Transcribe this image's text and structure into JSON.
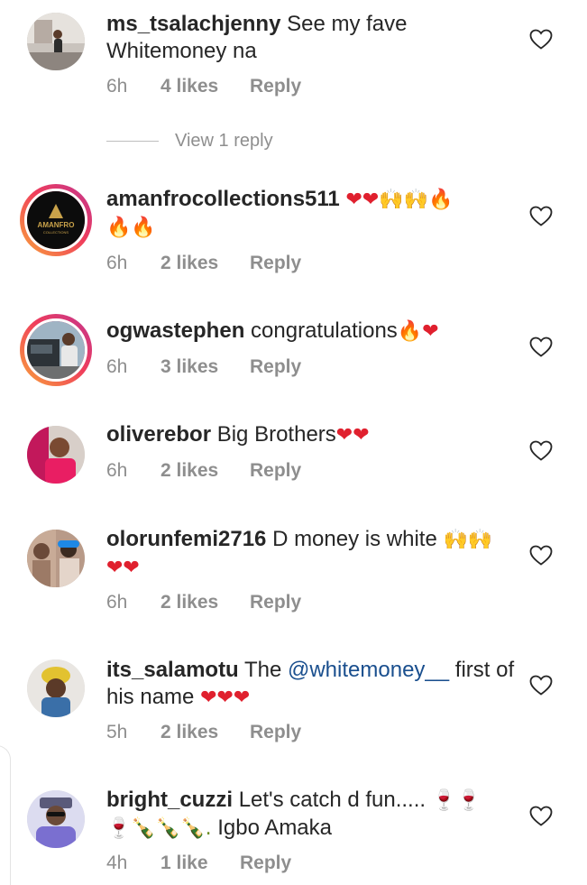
{
  "comments": [
    {
      "username": "ms_tsalachjenny",
      "text": "See my fave Whitemoney na",
      "time": "6h",
      "likes": "4 likes",
      "reply": "Reply",
      "view_replies": "View 1 reply",
      "avatar_ring": false
    },
    {
      "username": "amanfrocollections511",
      "text": "",
      "emoji_line1": "❤❤🙌🙌🔥",
      "emoji_line2": "🔥🔥",
      "time": "6h",
      "likes": "2 likes",
      "reply": "Reply",
      "avatar_ring": true,
      "avatar_logo": "AMANFRO",
      "avatar_logo_sub": "COLLECTIONS"
    },
    {
      "username": "ogwastephen",
      "text": "congratulations",
      "emoji": "🔥❤",
      "time": "6h",
      "likes": "3 likes",
      "reply": "Reply",
      "avatar_ring": true
    },
    {
      "username": "oliverebor",
      "text": "Big Brothers",
      "emoji": "❤❤",
      "time": "6h",
      "likes": "2 likes",
      "reply": "Reply",
      "avatar_ring": false
    },
    {
      "username": "olorunfemi2716",
      "text": "D money is white",
      "emoji_line1": "🙌🙌",
      "emoji_line2": "❤❤",
      "time": "6h",
      "likes": "2 likes",
      "reply": "Reply",
      "avatar_ring": false
    },
    {
      "username": "its_salamotu",
      "text_before": "The",
      "mention": "@whitemoney__",
      "text_after": "first of his name",
      "emoji": "❤❤❤",
      "time": "5h",
      "likes": "2 likes",
      "reply": "Reply",
      "avatar_ring": false
    },
    {
      "username": "bright_cuzzi",
      "text": "Let's catch d fun.....",
      "emoji_line1": "🍷🍷",
      "emoji_line2": "🍷🍾🍾🍾.",
      "text_line2": "Igbo Amaka",
      "time": "4h",
      "likes": "1 like",
      "reply": "Reply",
      "avatar_ring": false
    }
  ],
  "colors": {
    "text": "#262626",
    "meta": "#8e8e8e",
    "mention": "#1a4f8e",
    "heart": "#e0202e"
  },
  "icons": {
    "like": "heart-outline-icon"
  }
}
